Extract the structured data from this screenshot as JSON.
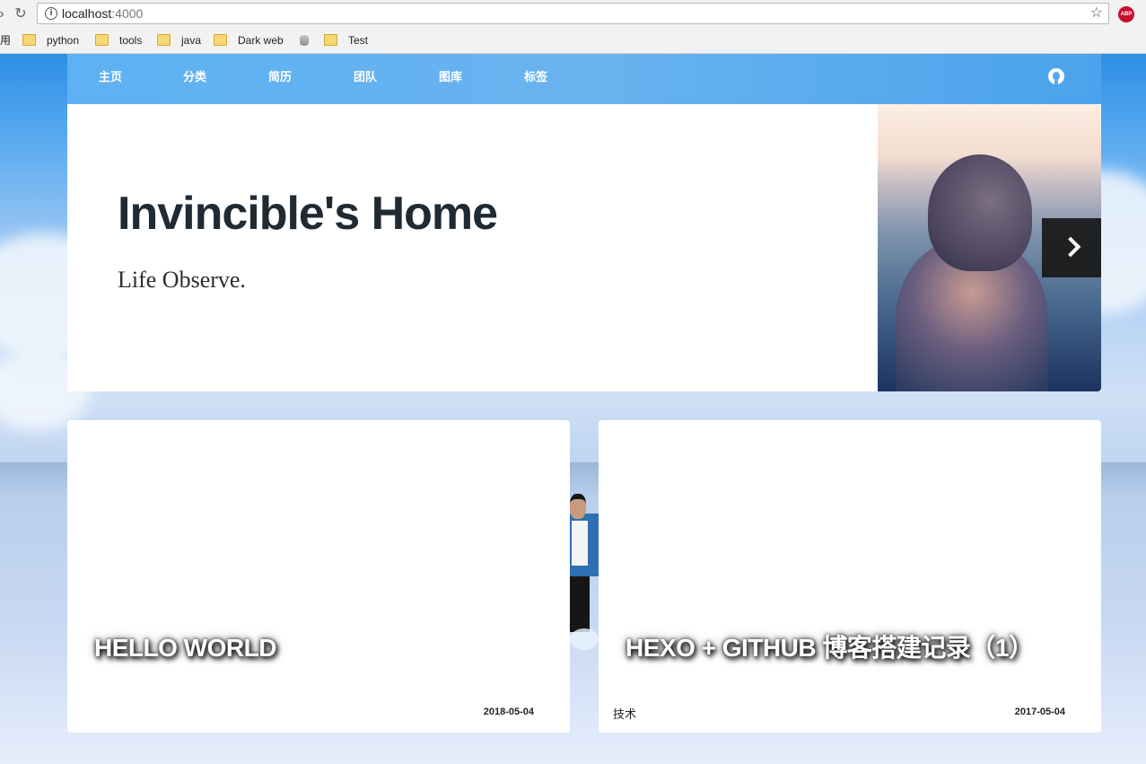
{
  "browser": {
    "url_host": "localhost",
    "url_port": ":4000",
    "bookmarks": [
      "用",
      "python",
      "tools",
      "java",
      "Dark web",
      "Test"
    ],
    "extension_label": "ABP"
  },
  "site": {
    "nav": [
      "主页",
      "分类",
      "简历",
      "团队",
      "图库",
      "标签"
    ],
    "hero": {
      "title": "Invincible's Home",
      "subtitle": "Life Observe."
    },
    "posts": [
      {
        "title": "HELLO WORLD",
        "category": "",
        "date": "2018-05-04"
      },
      {
        "title": "HEXO + GITHUB 博客搭建记录（1）",
        "category": "技术",
        "date": "2017-05-04"
      }
    ]
  },
  "colors": {
    "nav_bg": "#5eb1f2",
    "hero_title": "#1f2a33",
    "card_bg": "#ffffff"
  }
}
